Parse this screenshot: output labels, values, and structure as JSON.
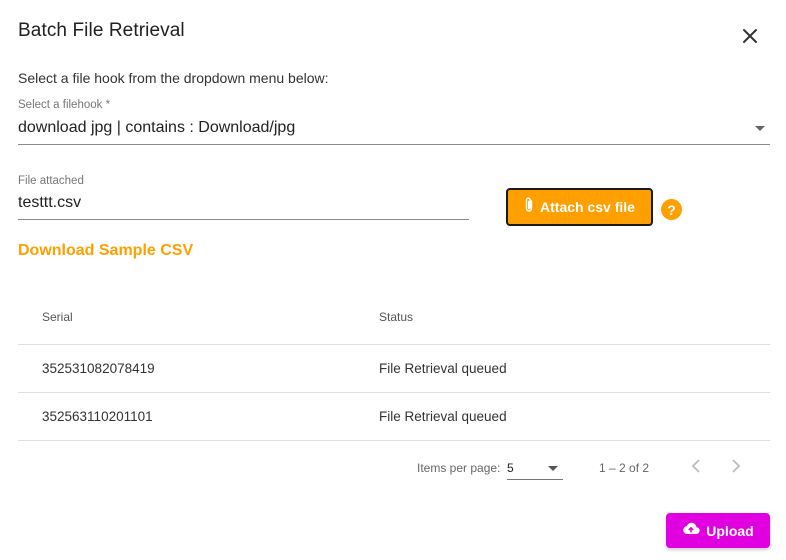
{
  "dialog": {
    "title": "Batch File Retrieval",
    "close_icon": "close-icon",
    "instruction": "Select a file hook from the dropdown menu below:"
  },
  "filehook": {
    "label": "Select a filehook *",
    "value": "download jpg | contains : Download/jpg",
    "icon": "dropdown-arrow-icon"
  },
  "file": {
    "label": "File attached",
    "value": "testtt.csv"
  },
  "attach_button": {
    "label": "Attach csv file",
    "icon": "paperclip-icon"
  },
  "help": {
    "glyph": "?",
    "icon": "help-icon"
  },
  "sample_link": "Download Sample CSV",
  "table": {
    "headers": [
      "Serial",
      "Status"
    ],
    "rows": [
      [
        "352531082078419",
        "File Retrieval queued"
      ],
      [
        "352563110201101",
        "File Retrieval queued"
      ]
    ]
  },
  "paginator": {
    "items_per_page_label": "Items per page:",
    "page_size": "5",
    "range": "1 – 2 of 2",
    "prev_icon": "chevron-left-icon",
    "next_icon": "chevron-right-icon"
  },
  "upload_button": {
    "label": "Upload",
    "icon": "cloud-upload-icon"
  },
  "colors": {
    "accent": "#ff9f00",
    "upload": "#e000e0"
  }
}
